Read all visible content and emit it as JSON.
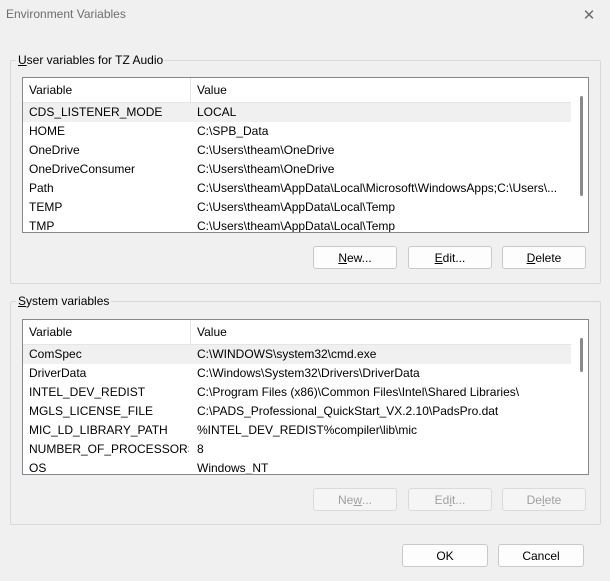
{
  "window": {
    "title": "Environment Variables",
    "close_glyph": "✕"
  },
  "user_vars": {
    "group_label_prefix": "U",
    "group_label_rest": "ser variables for TZ Audio",
    "columns": [
      "Variable",
      "Value"
    ],
    "rows": [
      {
        "variable": "CDS_LISTENER_MODE",
        "value": "LOCAL",
        "selected": true
      },
      {
        "variable": "HOME",
        "value": "C:\\SPB_Data"
      },
      {
        "variable": "OneDrive",
        "value": "C:\\Users\\theam\\OneDrive"
      },
      {
        "variable": "OneDriveConsumer",
        "value": "C:\\Users\\theam\\OneDrive"
      },
      {
        "variable": "Path",
        "value": "C:\\Users\\theam\\AppData\\Local\\Microsoft\\WindowsApps;C:\\Users\\..."
      },
      {
        "variable": "TEMP",
        "value": "C:\\Users\\theam\\AppData\\Local\\Temp"
      },
      {
        "variable": "TMP",
        "value": "C:\\Users\\theam\\AppData\\Local\\Temp"
      }
    ],
    "buttons": {
      "new_prefix": "N",
      "new_rest": "ew...",
      "edit_prefix": "E",
      "edit_rest": "dit...",
      "delete_prefix": "D",
      "delete_rest": "elete"
    }
  },
  "system_vars": {
    "group_label_prefix": "S",
    "group_label_rest": "ystem variables",
    "columns": [
      "Variable",
      "Value"
    ],
    "rows": [
      {
        "variable": "ComSpec",
        "value": "C:\\WINDOWS\\system32\\cmd.exe",
        "selected": true
      },
      {
        "variable": "DriverData",
        "value": "C:\\Windows\\System32\\Drivers\\DriverData"
      },
      {
        "variable": "INTEL_DEV_REDIST",
        "value": "C:\\Program Files (x86)\\Common Files\\Intel\\Shared Libraries\\"
      },
      {
        "variable": "MGLS_LICENSE_FILE",
        "value": "C:\\PADS_Professional_QuickStart_VX.2.10\\PadsPro.dat"
      },
      {
        "variable": "MIC_LD_LIBRARY_PATH",
        "value": "%INTEL_DEV_REDIST%compiler\\lib\\mic"
      },
      {
        "variable": "NUMBER_OF_PROCESSORS",
        "value": "8"
      },
      {
        "variable": "OS",
        "value": "Windows_NT"
      }
    ],
    "buttons": {
      "new_a": "Ne",
      "new_u": "w",
      "new_b": "...",
      "edit_a": "Ed",
      "edit_u": "i",
      "edit_b": "t...",
      "delete_a": "De",
      "delete_u": "l",
      "delete_b": "ete"
    }
  },
  "footer": {
    "ok_label": "OK",
    "cancel_label": "Cancel"
  }
}
